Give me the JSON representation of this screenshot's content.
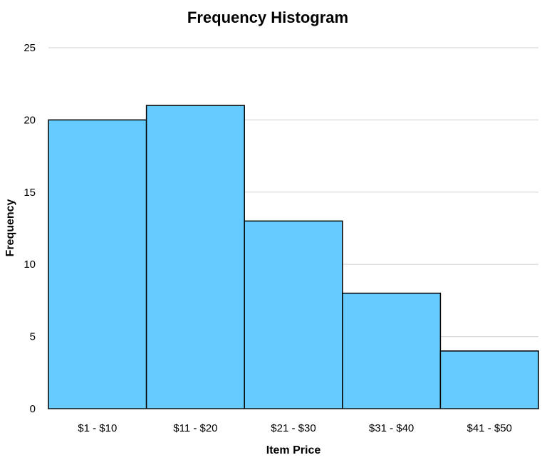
{
  "chart_data": {
    "type": "bar",
    "title": "Frequency Histogram",
    "xlabel": "Item Price",
    "ylabel": "Frequency",
    "categories": [
      "$1 - $10",
      "$11 - $20",
      "$21 - $30",
      "$31 - $40",
      "$41 - $50"
    ],
    "values": [
      20,
      21,
      13,
      8,
      4
    ],
    "ylim": [
      0,
      25
    ],
    "yticks": [
      0,
      5,
      10,
      15,
      20,
      25
    ],
    "grid": true,
    "legend": "none",
    "bar_gap": 0,
    "colors": {
      "bar_fill": "#66CCFF",
      "bar_stroke": "#000000",
      "grid": "#D9D9D9"
    }
  }
}
